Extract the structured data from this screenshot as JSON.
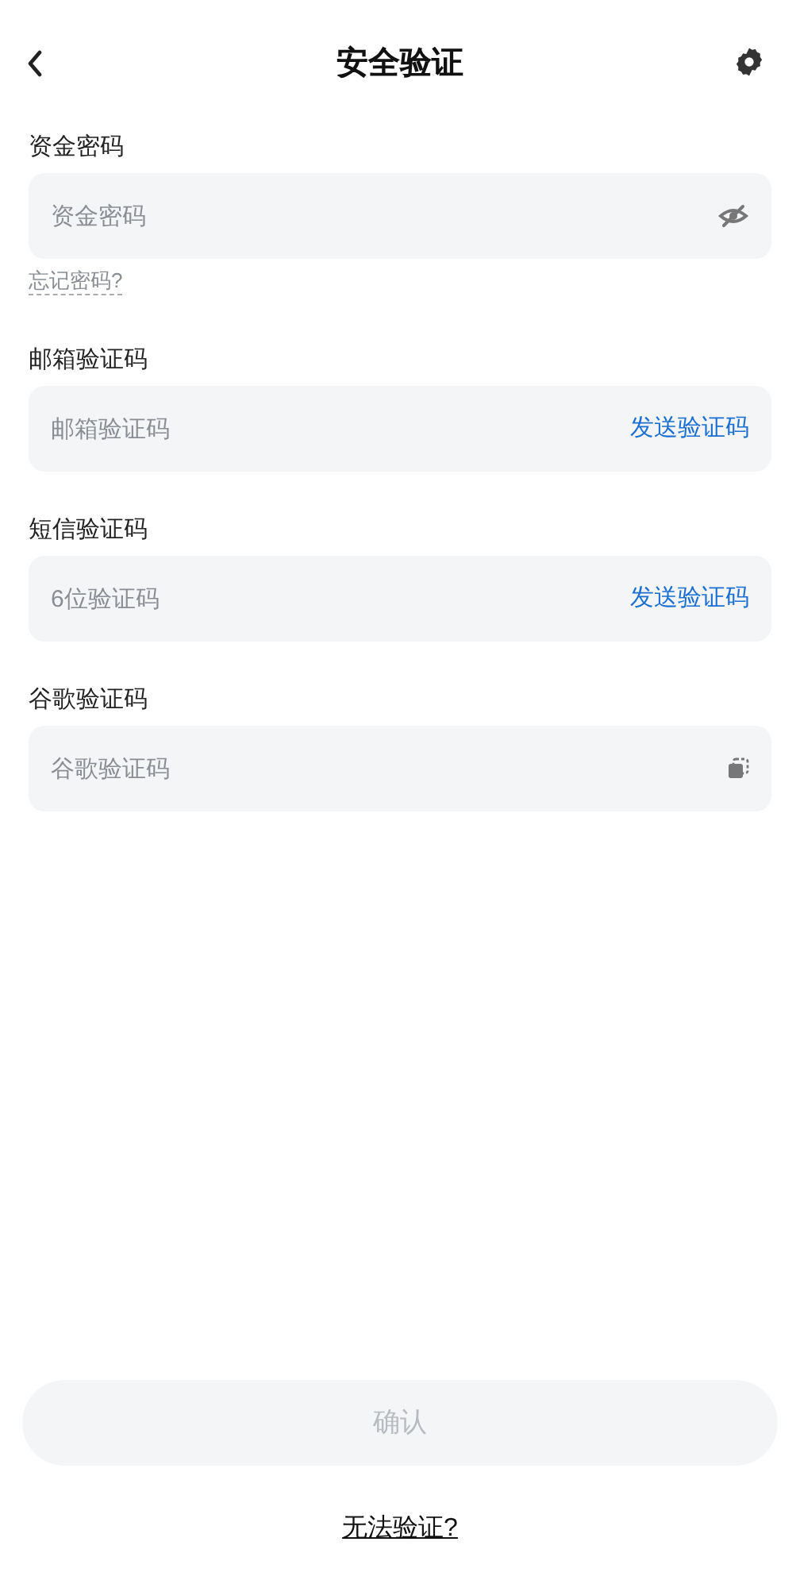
{
  "header": {
    "title": "安全验证"
  },
  "fields": [
    {
      "kind": "password",
      "label": "资金密码",
      "placeholder": "资金密码",
      "link": "忘记密码?"
    },
    {
      "kind": "send",
      "label": "邮箱验证码",
      "placeholder": "邮箱验证码",
      "action": "发送验证码"
    },
    {
      "kind": "send",
      "label": "短信验证码",
      "placeholder": "6位验证码",
      "action": "发送验证码"
    },
    {
      "kind": "paste",
      "label": "谷歌验证码",
      "placeholder": "谷歌验证码"
    }
  ],
  "confirm": {
    "label": "确认",
    "disabled": true
  },
  "help_link": "无法验证?"
}
